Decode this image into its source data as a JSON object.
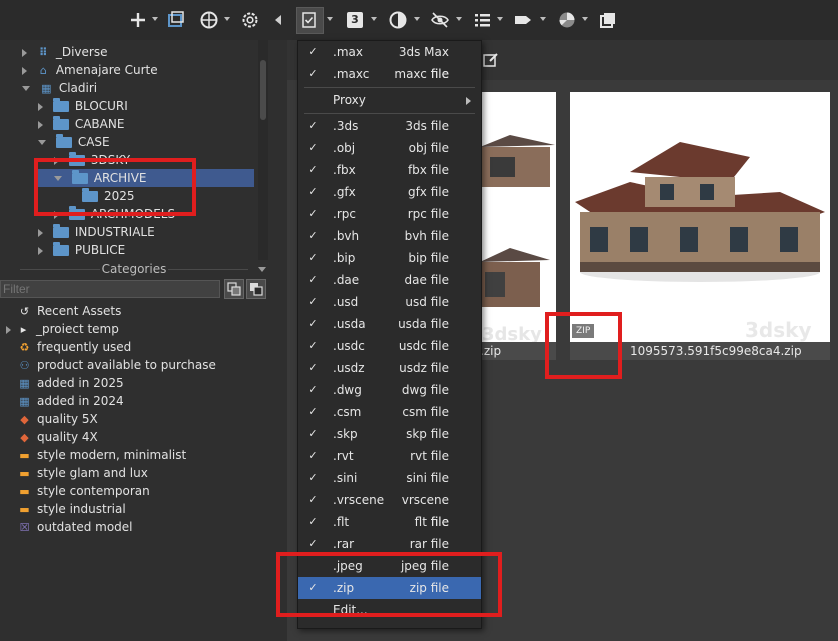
{
  "toolbar": {
    "left_icons": [
      "plus-icon",
      "window-icon",
      "globe-icon",
      "gear-icon"
    ],
    "right_icons": [
      "checklist-icon",
      "number-badge-icon",
      "half-circle-icon",
      "hidden-eye-icon",
      "list-icon",
      "tag-icon",
      "pie-icon",
      "copy-icon"
    ],
    "badge_number": "3"
  },
  "tree": {
    "items": [
      {
        "label": "_Diverse"
      },
      {
        "label": "Amenajare Curte"
      },
      {
        "label": "Cladiri"
      },
      {
        "label": "BLOCURI"
      },
      {
        "label": "CABANE"
      },
      {
        "label": "CASE"
      },
      {
        "label": "3DSKY"
      },
      {
        "label": "ARCHIVE"
      },
      {
        "label": "2025"
      },
      {
        "label": "ARCHMODELS"
      },
      {
        "label": "INDUSTRIALE"
      },
      {
        "label": "PUBLICE"
      }
    ]
  },
  "categories": {
    "header": "Categories",
    "filter_placeholder": "Filter",
    "items": [
      {
        "label": "Recent Assets",
        "icon": "history-icon",
        "color": "#e6e6e6"
      },
      {
        "label": "_proiect temp",
        "icon": "tag-icon",
        "color": "#e6e6e6"
      },
      {
        "label": "frequently used",
        "icon": "recycle-icon",
        "color": "#f0a030"
      },
      {
        "label": "product available to purchase",
        "icon": "network-icon",
        "color": "#5d95c9"
      },
      {
        "label": "added in 2025",
        "icon": "calendar-icon",
        "color": "#5d95c9"
      },
      {
        "label": "added in 2024",
        "icon": "calendar-icon",
        "color": "#5d95c9"
      },
      {
        "label": "quality 5X",
        "icon": "diamond-icon",
        "color": "#e0663a"
      },
      {
        "label": "quality 4X",
        "icon": "diamond-icon",
        "color": "#e0663a"
      },
      {
        "label": "style modern, minimalist",
        "icon": "sofa-icon",
        "color": "#f0a030"
      },
      {
        "label": "style glam and lux",
        "icon": "sofa-icon",
        "color": "#f0a030"
      },
      {
        "label": "style contemporan",
        "icon": "sofa-icon",
        "color": "#f0a030"
      },
      {
        "label": "style industrial",
        "icon": "sofa-icon",
        "color": "#f0a030"
      },
      {
        "label": "outdated model",
        "icon": "x-box-icon",
        "color": "#8c7cc9"
      }
    ]
  },
  "thumbnails": [
    {
      "caption": ".zip",
      "badge": ""
    },
    {
      "caption": "1095573.591f5c99e8ca4.zip",
      "badge": "ZIP",
      "watermark": "3dsky"
    }
  ],
  "menu": {
    "items": [
      {
        "ext": ".max",
        "desc": "3ds Max file",
        "checked": true
      },
      {
        "ext": ".maxc",
        "desc": "maxc file",
        "checked": true
      },
      {
        "ext": "Proxy",
        "desc": "",
        "checked": false,
        "submenu": true
      },
      {
        "ext": ".3ds",
        "desc": "3ds file",
        "checked": true
      },
      {
        "ext": ".obj",
        "desc": "obj file",
        "checked": true
      },
      {
        "ext": ".fbx",
        "desc": "fbx file",
        "checked": true
      },
      {
        "ext": ".gfx",
        "desc": "gfx file",
        "checked": true
      },
      {
        "ext": ".rpc",
        "desc": "rpc file",
        "checked": true
      },
      {
        "ext": ".bvh",
        "desc": "bvh file",
        "checked": true
      },
      {
        "ext": ".bip",
        "desc": "bip file",
        "checked": true
      },
      {
        "ext": ".dae",
        "desc": "dae file",
        "checked": true
      },
      {
        "ext": ".usd",
        "desc": "usd file",
        "checked": true
      },
      {
        "ext": ".usda",
        "desc": "usda file",
        "checked": true
      },
      {
        "ext": ".usdc",
        "desc": "usdc file",
        "checked": true
      },
      {
        "ext": ".usdz",
        "desc": "usdz file",
        "checked": true
      },
      {
        "ext": ".dwg",
        "desc": "dwg file",
        "checked": true
      },
      {
        "ext": ".csm",
        "desc": "csm file",
        "checked": true
      },
      {
        "ext": ".skp",
        "desc": "skp file",
        "checked": true
      },
      {
        "ext": ".rvt",
        "desc": "rvt file",
        "checked": true
      },
      {
        "ext": ".sini",
        "desc": "sini file",
        "checked": true
      },
      {
        "ext": ".vrscene",
        "desc": "vrscene file",
        "checked": true
      },
      {
        "ext": ".flt",
        "desc": "flt file",
        "checked": true
      },
      {
        "ext": ".rar",
        "desc": "rar file",
        "checked": true
      },
      {
        "ext": ".jpeg",
        "desc": "jpeg file",
        "checked": false
      },
      {
        "ext": ".zip",
        "desc": "zip file",
        "checked": true,
        "active": true
      },
      {
        "ext": "Edit...",
        "desc": "",
        "checked": false
      }
    ]
  },
  "colors": {
    "accent": "#3a68b0",
    "highlight_red": "#e01e1e",
    "folder": "#5d95c9"
  }
}
